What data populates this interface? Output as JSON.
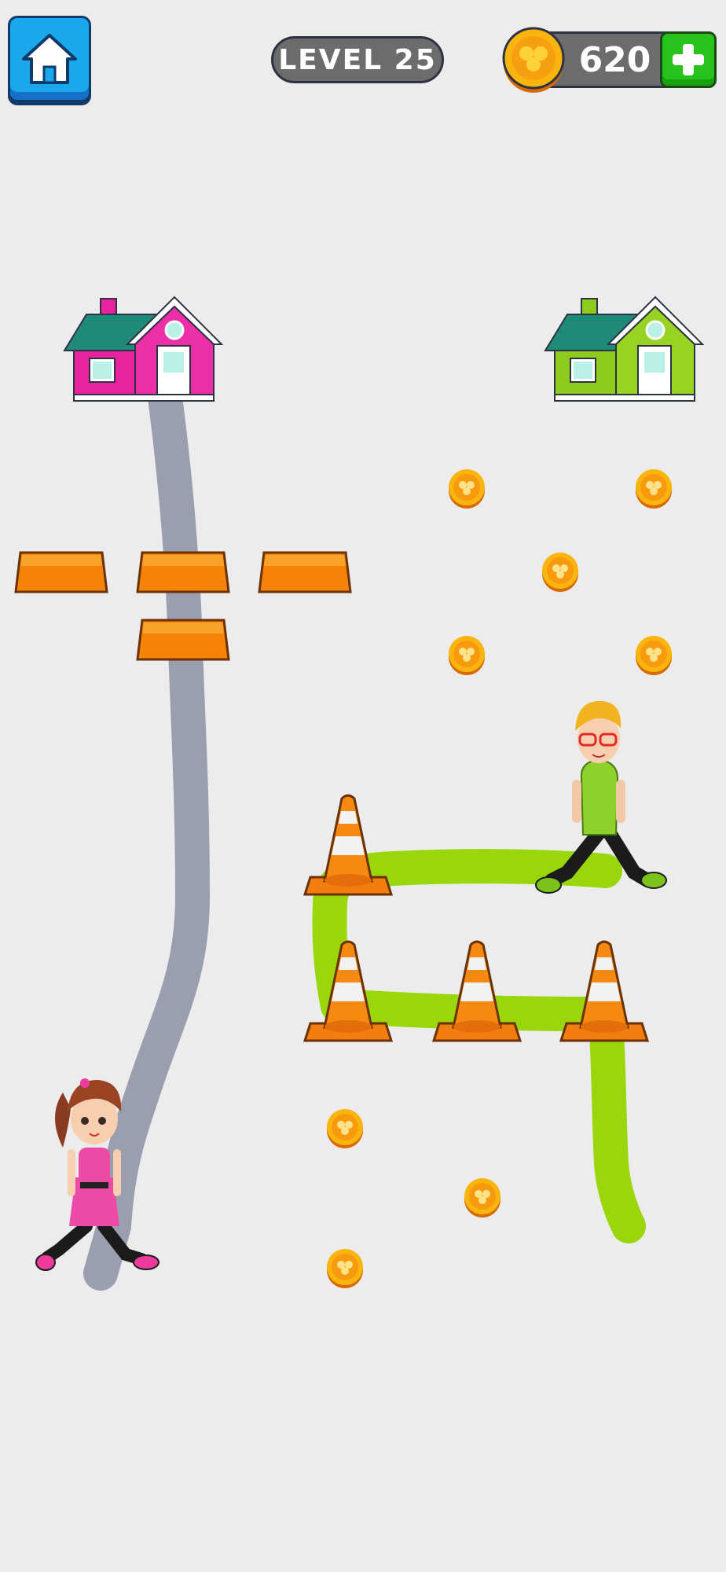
{
  "hud": {
    "level_label": "LEVEL 25",
    "coins": "620"
  },
  "icons": {
    "home": "home-icon",
    "coin": "clover-coin-icon",
    "add": "plus-icon"
  },
  "colors": {
    "girl_house": "#e9239f",
    "boy_house": "#8fcb1c",
    "girl_path": "#9b9eae",
    "boy_path": "#99d70c",
    "barrier": "#f5830a",
    "cone": "#f27e10"
  }
}
